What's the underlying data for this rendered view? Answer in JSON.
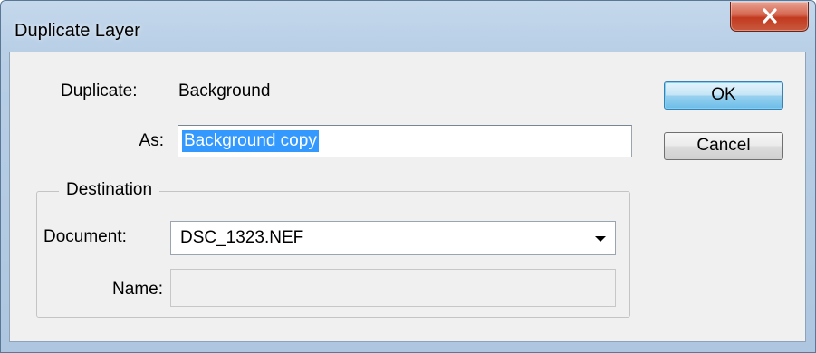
{
  "window": {
    "title": "Duplicate Layer",
    "close_icon": "close-icon"
  },
  "form": {
    "duplicate_label": "Duplicate:",
    "duplicate_value": "Background",
    "as_label": "As:",
    "as_value": "Background copy"
  },
  "buttons": {
    "ok": "OK",
    "cancel": "Cancel"
  },
  "destination": {
    "legend": "Destination",
    "document_label": "Document:",
    "document_value": "DSC_1323.NEF",
    "name_label": "Name:",
    "name_value": ""
  },
  "colors": {
    "selection": "#3399ff",
    "default_button": "#98d1ef",
    "close_button": "#c23a1f"
  }
}
